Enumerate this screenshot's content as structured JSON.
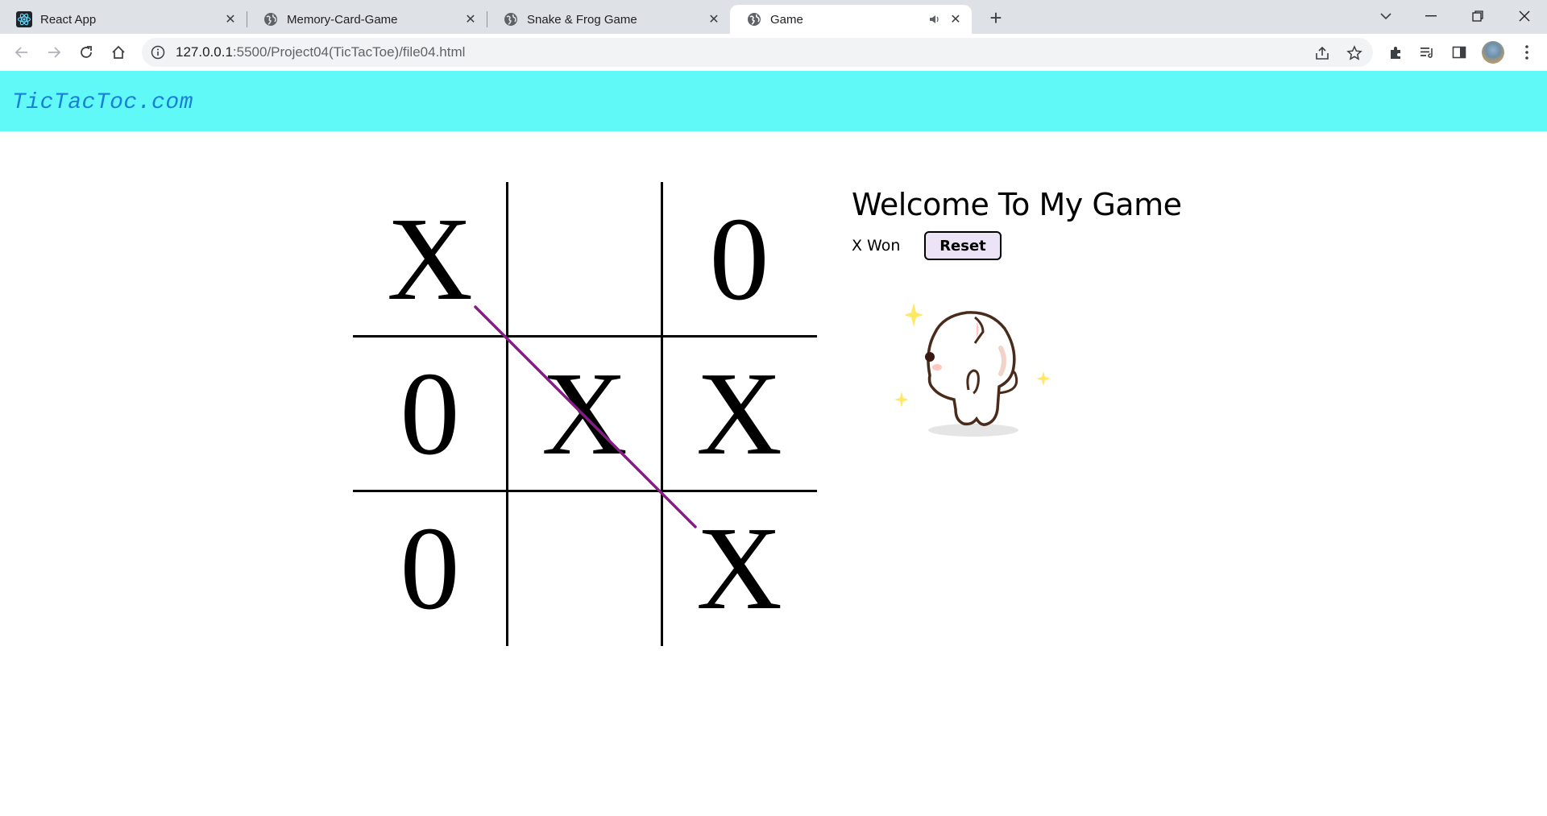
{
  "browser": {
    "tabs": [
      {
        "title": "React App",
        "icon": "react-icon",
        "active": false
      },
      {
        "title": "Memory-Card-Game",
        "icon": "globe-icon",
        "active": false
      },
      {
        "title": "Snake & Frog Game",
        "icon": "globe-icon",
        "active": false
      },
      {
        "title": "Game",
        "icon": "globe-icon",
        "active": true,
        "audio": true
      }
    ],
    "new_tab_label": "+",
    "url_host": "127.0.0.1",
    "url_path": ":5500/Project04(TicTacToe)/file04.html"
  },
  "site": {
    "brand": "TicTacToc.com",
    "header_color": "#61f8f8"
  },
  "game": {
    "welcome": "Welcome To My Game",
    "status": "X Won",
    "reset_label": "Reset",
    "cells": [
      "X",
      "",
      "0",
      "0",
      "X",
      "X",
      "0",
      "",
      "X"
    ],
    "win_line_color": "#8a1a8a",
    "winning_cells": [
      0,
      4,
      8
    ]
  }
}
